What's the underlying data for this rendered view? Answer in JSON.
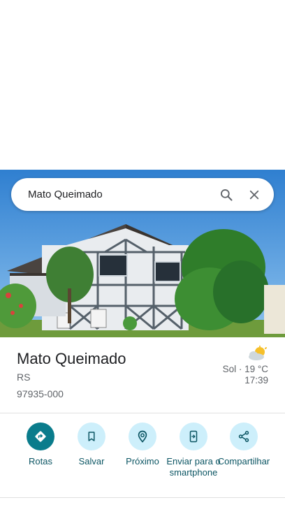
{
  "search": {
    "query": "Mato Queimado"
  },
  "place": {
    "name": "Mato Queimado",
    "state": "RS",
    "postal_code": "97935-000"
  },
  "weather": {
    "summary": "Sol · 19 °C",
    "time": "17:39",
    "icon": "partly-sunny-icon"
  },
  "actions": [
    {
      "label": "Rotas",
      "icon": "directions-icon"
    },
    {
      "label": "Salvar",
      "icon": "bookmark-icon"
    },
    {
      "label": "Próximo",
      "icon": "nearby-icon"
    },
    {
      "label": "Enviar para o smartphone",
      "icon": "send-to-phone-icon"
    },
    {
      "label": "Compartilhar",
      "icon": "share-icon"
    }
  ],
  "colors": {
    "accent": "#0a7c8c",
    "action_bg": "#cdeffb",
    "action_text": "#0b5563"
  }
}
